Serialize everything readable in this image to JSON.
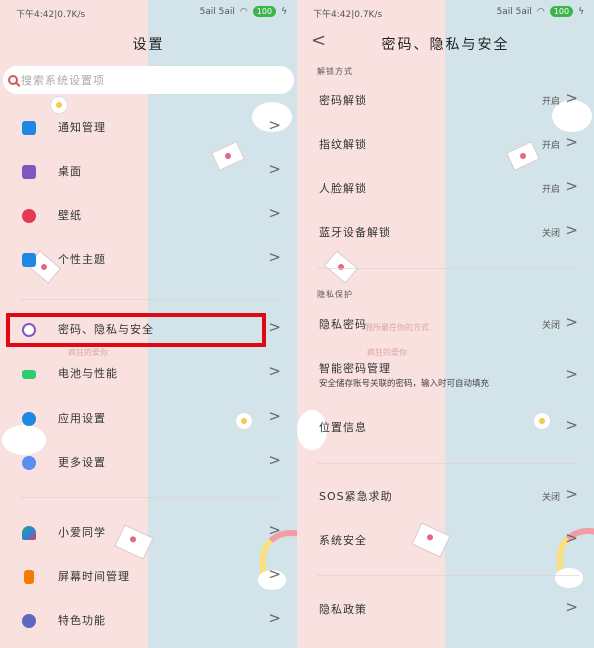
{
  "status": {
    "time_speed": "下午4:42|0.7K/s",
    "signal": "5ail 5ail",
    "battery": "100"
  },
  "left": {
    "title": "设置",
    "search_placeholder": "搜索系统设置项",
    "items": [
      {
        "label": "通知管理",
        "icon": "notification-icon",
        "color": "#1e88e5"
      },
      {
        "label": "桌面",
        "icon": "home-icon",
        "color": "#7e57c2"
      },
      {
        "label": "壁纸",
        "icon": "wallpaper-icon",
        "color": "#e53950"
      },
      {
        "label": "个性主题",
        "icon": "theme-icon",
        "color": "#1e88e5"
      },
      {
        "label": "密码、隐私与安全",
        "icon": "fingerprint-icon",
        "color": "#7e57c2"
      },
      {
        "label": "电池与性能",
        "icon": "battery-icon",
        "color": "#2ecc71"
      },
      {
        "label": "应用设置",
        "icon": "gear-icon",
        "color": "#1e88e5"
      },
      {
        "label": "更多设置",
        "icon": "more-icon",
        "color": "#5a8df0"
      },
      {
        "label": "小爱同学",
        "icon": "xiaoai-icon",
        "color": "#43a047"
      },
      {
        "label": "屏幕时间管理",
        "icon": "hourglass-icon",
        "color": "#f57c00"
      },
      {
        "label": "特色功能",
        "icon": "flask-icon",
        "color": "#5c6bc0"
      }
    ]
  },
  "right": {
    "title": "密码、隐私与安全",
    "section_unlock": "解锁方式",
    "section_privacy": "隐私保护",
    "items": [
      {
        "label": "密码解锁",
        "value": "开启"
      },
      {
        "label": "指纹解锁",
        "value": "开启"
      },
      {
        "label": "人脸解锁",
        "value": "开启"
      },
      {
        "label": "蓝牙设备解锁",
        "value": "关闭"
      },
      {
        "label": "隐私密码",
        "value": "关闭"
      },
      {
        "label": "智能密码管理",
        "sub": "安全储存账号关联的密码，输入时可自动填充"
      },
      {
        "label": "位置信息"
      },
      {
        "label": "SOS紧急求助",
        "value": "关闭"
      },
      {
        "label": "系统安全"
      },
      {
        "label": "隐私政策"
      }
    ]
  },
  "watermarks": [
    "疯狂的爱你",
    "我所最在你的方式"
  ]
}
